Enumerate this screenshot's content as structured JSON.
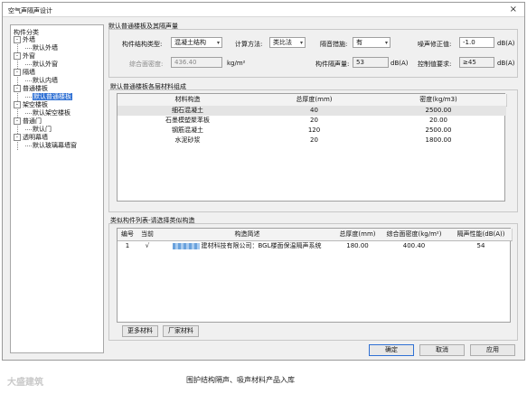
{
  "window": {
    "title": "空气声隔声设计",
    "close_glyph": "×"
  },
  "tree": {
    "root": "构件分类",
    "items": [
      {
        "label": "外墙",
        "toggle": "⊟"
      },
      {
        "label": "默认外墙"
      },
      {
        "label": "外窗",
        "toggle": "⊟"
      },
      {
        "label": "默认外窗"
      },
      {
        "label": "隔墙",
        "toggle": "⊟"
      },
      {
        "label": "默认内墙"
      },
      {
        "label": "普通楼板",
        "toggle": "⊟"
      },
      {
        "label": "默认普通楼板",
        "selected": true
      },
      {
        "label": "架空楼板",
        "toggle": "⊟"
      },
      {
        "label": "默认架空楼板"
      },
      {
        "label": "普通门",
        "toggle": "⊟"
      },
      {
        "label": "默认门"
      },
      {
        "label": "透明幕墙",
        "toggle": "⊟"
      },
      {
        "label": "默认玻璃幕墙窗"
      }
    ]
  },
  "params": {
    "group_title": "默认普通楼板及其隔声量",
    "structure_type_label": "构件结构类型:",
    "structure_type_value": "混凝土结构",
    "calc_method_label": "计算方法:",
    "calc_method_value": "类比法",
    "measure_label": "隔音措施:",
    "measure_value": "有",
    "correction_label": "噪声修正值:",
    "correction_value": "-1.0",
    "correction_unit": "dB(A)",
    "density_label": "综合面密度:",
    "density_value": "436.40",
    "density_unit": "kg/m²",
    "insulation_label": "构件隔声量:",
    "insulation_value": "53",
    "insulation_unit": "dB(A)",
    "control_label": "控制值要求:",
    "control_value": "≥45",
    "control_unit": "dB(A)"
  },
  "layers": {
    "group_title": "默认普通楼板各层材料组成",
    "columns": [
      "材料构造",
      "总厚度(mm)",
      "密度(kg/m3)"
    ],
    "rows": [
      [
        "细石混凝土",
        "40",
        "2500.00"
      ],
      [
        "石墨模塑聚苯板",
        "20",
        "20.00"
      ],
      [
        "钢筋混凝土",
        "120",
        "2500.00"
      ],
      [
        "水泥砂浆",
        "20",
        "1800.00"
      ]
    ]
  },
  "similar": {
    "group_title": "类似构件列表-请选择类似构造",
    "columns": [
      "编号",
      "当前",
      "构造简述",
      "总厚度(mm)",
      "综合面密度(kg/m²)",
      "隔声性能(dB(A))"
    ],
    "rows": [
      [
        "1",
        "√",
        "建材科技有限公司：BGL楼面保温隔声系统",
        "180.00",
        "400.40",
        "54"
      ]
    ]
  },
  "buttons": {
    "more_materials": "更多材料",
    "vendor_materials": "厂家材料",
    "ok": "确定",
    "cancel": "取消",
    "apply": "应用"
  },
  "watermark": "大盛建筑",
  "caption": "围护结构隔声、吸声材料产品入库"
}
